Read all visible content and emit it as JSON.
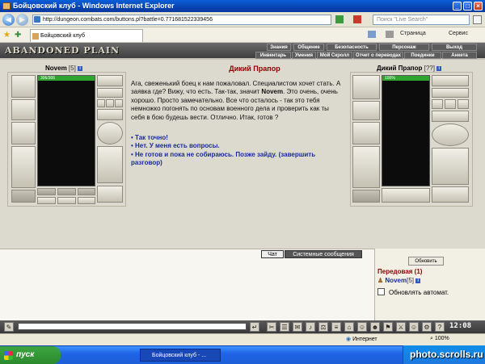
{
  "window": {
    "title": "Бойцовский клуб - Windows Internet Explorer"
  },
  "address": {
    "url": "http://dungeon.combats.com/buttons.pl?battle=0.771681522339456",
    "search_placeholder": "Поиск \"Live Search\""
  },
  "tabs": {
    "active": "Бойцовский клуб"
  },
  "ie_toolbar": {
    "page": "Страница",
    "service": "Сервис"
  },
  "game": {
    "logo": "ABANDONED PLAIN",
    "menu_top": [
      "Знания",
      "Общение",
      "Безопасность",
      "Персонаж",
      "Выход"
    ],
    "menu_bottom": [
      "Инвентарь",
      "Умения",
      "Мой Скролл",
      "Отчет о переводах",
      "Поединки",
      "Анкета"
    ]
  },
  "player": {
    "name": "Novem",
    "level": "[5]",
    "hp_text": "306/306",
    "hp_fraction": 1.0
  },
  "enemy": {
    "name": "Дикий Прапор",
    "level": "[??]",
    "hp_text": "100%",
    "hp_fraction": 1.0
  },
  "dialog": {
    "title": "Дикий Прапор",
    "text_before": "Ага, свеженький боец к нам пожаловал. Специалистом хочет стать. А заявка где? Вижу, что есть. Так-так, значит ",
    "text_bold": "Novem",
    "text_after": ". Это очень, очень хорошо. Просто замечательно. Все что осталось - так это тебя немножко погонять по основам военного дела и проверить как ты себя в бою будешь вести. Отлично. Итак, готов ?",
    "answers": [
      "Так точно!",
      "Нет. У меня есть вопросы.",
      "Не готов и пока не собираюсь. Позже зайду. (завершить разговор)"
    ]
  },
  "chat": {
    "tab_chat": "Чат",
    "tab_system": "Системные сообщения"
  },
  "room": {
    "refresh": "Обновить",
    "name": "Передовая (1)",
    "user_name": "Novem",
    "user_level": "[5]",
    "auto_refresh": "Обновлять автомат."
  },
  "clock": "12:08",
  "status": {
    "zone": "Интернет",
    "zoom": "100%"
  },
  "taskbar": {
    "start": "пуск",
    "item": "Бойцовский клуб - ..."
  },
  "watermark": "photo.scrolls.ru"
}
